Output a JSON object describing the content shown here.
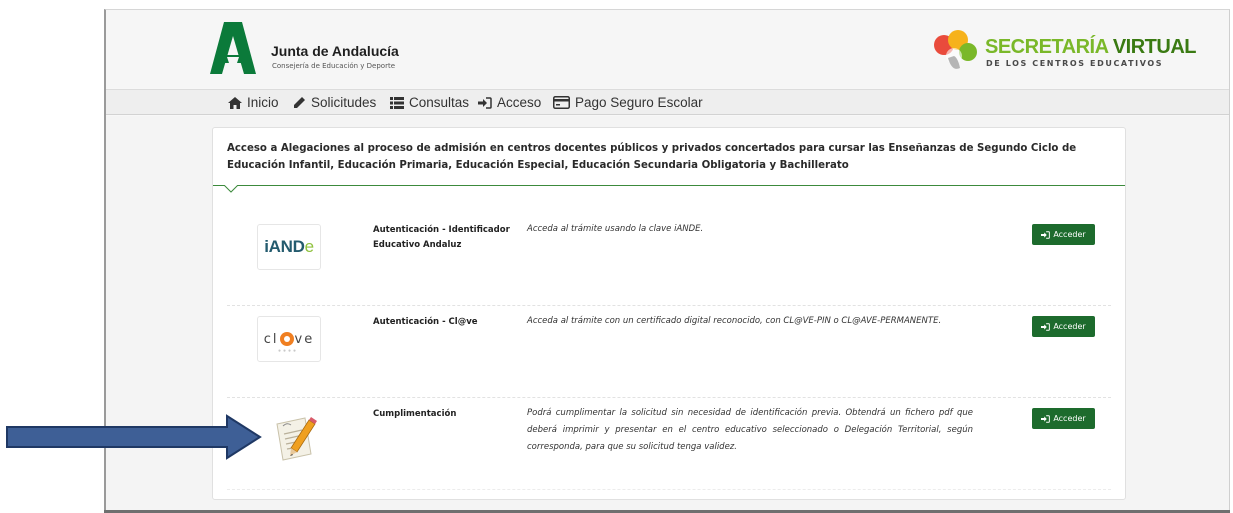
{
  "header": {
    "org_name": "Junta de Andalucía",
    "org_sub": "Consejería de Educación y Deporte",
    "sv_title_light": "SECRETARÍA ",
    "sv_title_dark": "VIRTUAL",
    "sv_sub": "DE LOS CENTROS EDUCATIVOS",
    "colors": {
      "brand_green": "#0b7a3a",
      "sv_green": "#7ab829",
      "button_green": "#1d6b2d"
    }
  },
  "nav": {
    "items": [
      {
        "label": "Inicio",
        "icon": "home-icon"
      },
      {
        "label": "Solicitudes",
        "icon": "pencil-icon"
      },
      {
        "label": "Consultas",
        "icon": "list-icon"
      },
      {
        "label": "Acceso",
        "icon": "sign-in-icon"
      },
      {
        "label": "Pago Seguro Escolar",
        "icon": "credit-card-icon"
      }
    ]
  },
  "panel": {
    "title": "Acceso a Alegaciones al proceso de admisión en centros docentes públicos y privados concertados para cursar las Enseñanzas de Segundo Ciclo de Educación Infantil, Educación Primaria, Educación Especial, Educación Secundaria Obligatoria y Bachillerato"
  },
  "methods": [
    {
      "logo_text_main": "iAND",
      "logo_text_end": "e",
      "name": "Autenticación - Identificador Educativo Andaluz",
      "description": "Acceda al trámite usando la clave iANDE.",
      "button": "Acceder"
    },
    {
      "logo_text_left": "cl",
      "logo_text_right": "ve",
      "logo_dots": "●●●●",
      "name": "Autenticación - Cl@ve",
      "description": "Acceda al trámite con un certificado digital reconocido, con CL@VE-PIN o CL@AVE-PERMANENTE.",
      "button": "Acceder"
    },
    {
      "name": "Cumplimentación",
      "description": "Podrá cumplimentar la solicitud sin necesidad de identificación previa. Obtendrá un fichero pdf que deberá imprimir y presentar en el centro educativo seleccionado o Delegación Territorial, según corresponda, para que su solicitud tenga validez.",
      "button": "Acceder"
    }
  ]
}
